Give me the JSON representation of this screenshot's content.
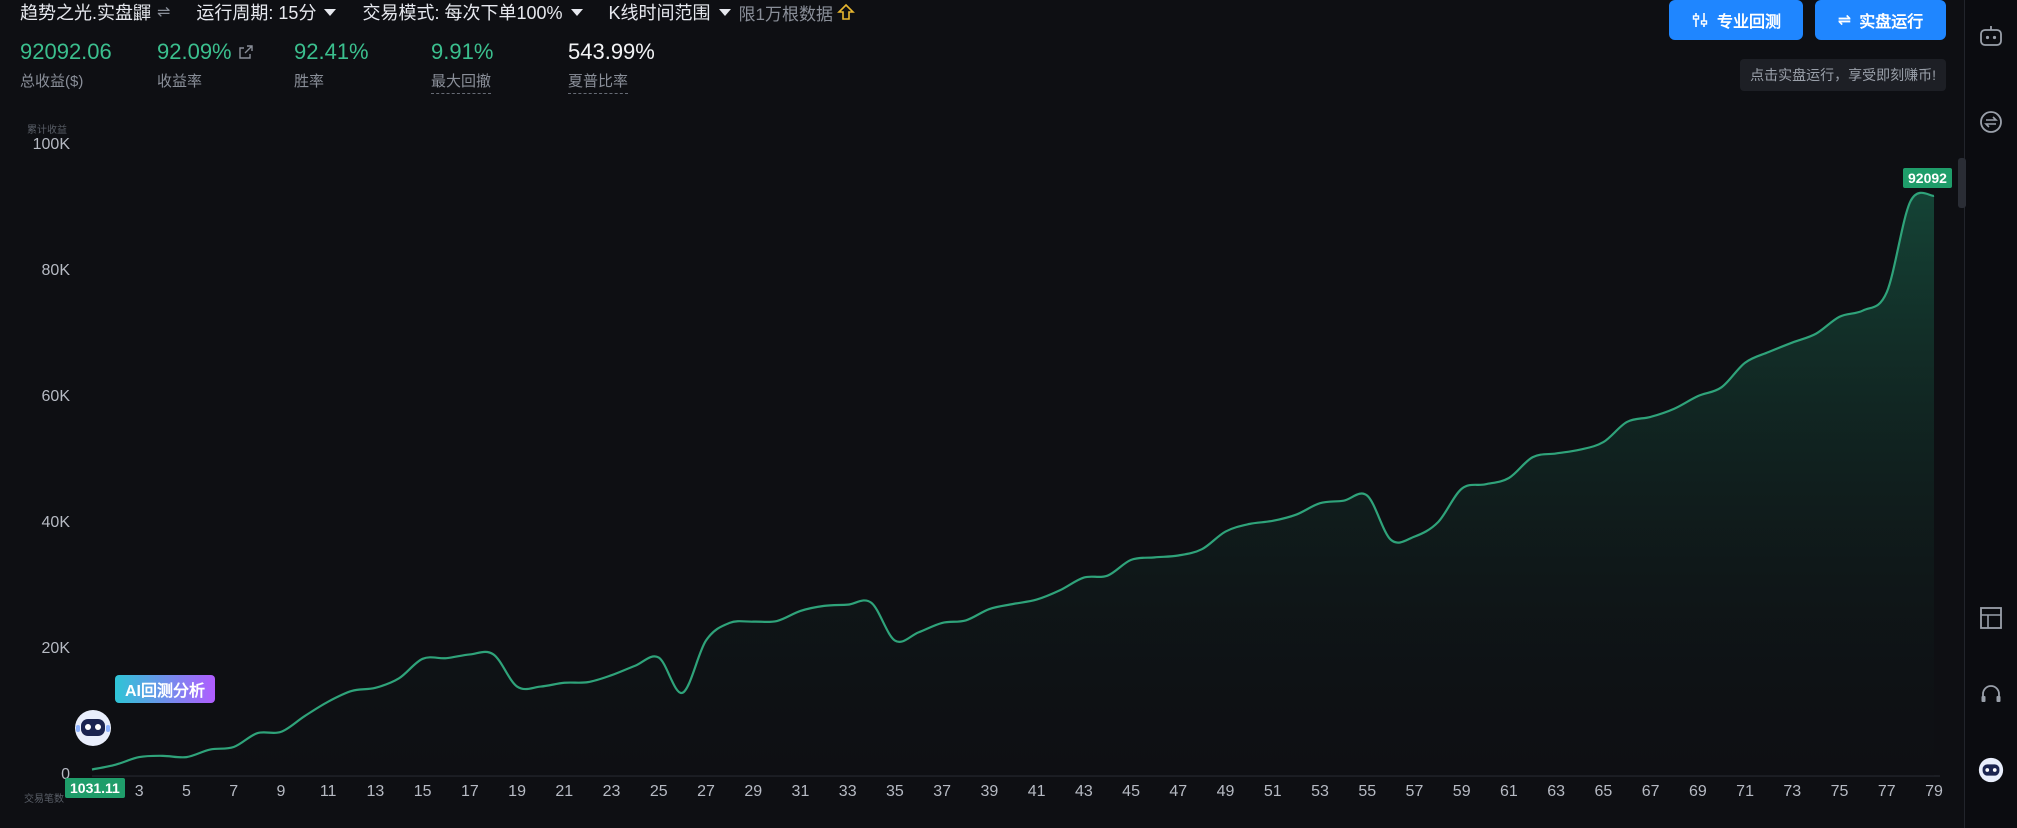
{
  "header": {
    "strategy_name": "趋势之光.实盘鼲",
    "period_label": "运行周期: 15分",
    "mode_label": "交易模式: 每次下单100%",
    "range_label": "K线时间范围",
    "range_note": "限1万根数据"
  },
  "buttons": {
    "pro_backtest": "专业回测",
    "live_run": "实盘运行"
  },
  "tip": "点击实盘运行，享受即刻赚币!",
  "stats": [
    {
      "value": "92092.06",
      "label": "总收益($)"
    },
    {
      "value": "92.09%",
      "label": "收益率"
    },
    {
      "value": "92.41%",
      "label": "胜率"
    },
    {
      "value": "9.91%",
      "label": "最大回撤"
    },
    {
      "value": "543.99%",
      "label": "夏普比率"
    }
  ],
  "chart_meta": {
    "y_title": "累计收益",
    "x_title": "交易笔数",
    "ai_tag": "AI回测分析",
    "start_label": "1031.11",
    "end_label": "92092"
  },
  "colors": {
    "line": "#2fa37a",
    "accent": "#1f86ff",
    "positive": "#3bbf8e"
  },
  "chart_data": {
    "type": "area",
    "ylim": [
      0,
      100000
    ],
    "yticks": [
      "100K",
      "80K",
      "60K",
      "40K",
      "20K",
      "0"
    ],
    "xticks": [
      "3",
      "5",
      "7",
      "9",
      "11",
      "13",
      "15",
      "17",
      "19",
      "21",
      "23",
      "25",
      "27",
      "29",
      "31",
      "33",
      "35",
      "37",
      "39",
      "41",
      "43",
      "45",
      "47",
      "49",
      "51",
      "53",
      "55",
      "57",
      "59",
      "61",
      "63",
      "65",
      "67",
      "69",
      "71",
      "73",
      "75",
      "77",
      "79"
    ],
    "x": [
      1,
      2,
      3,
      4,
      5,
      6,
      7,
      8,
      9,
      10,
      11,
      12,
      13,
      14,
      15,
      16,
      17,
      18,
      19,
      20,
      21,
      22,
      23,
      24,
      25,
      26,
      27,
      28,
      29,
      30,
      31,
      32,
      33,
      34,
      35,
      36,
      37,
      38,
      39,
      40,
      41,
      42,
      43,
      44,
      45,
      46,
      47,
      48,
      49,
      50,
      51,
      52,
      53,
      54,
      55,
      56,
      57,
      58,
      59,
      60,
      61,
      62,
      63,
      64,
      65,
      66,
      67,
      68,
      69,
      70,
      71,
      72,
      73,
      74,
      75,
      76,
      77,
      78,
      79
    ],
    "values": [
      1031,
      1800,
      3000,
      3200,
      3000,
      4200,
      4600,
      6800,
      7000,
      9500,
      11800,
      13500,
      14000,
      15500,
      18600,
      18700,
      19300,
      19300,
      14200,
      14200,
      14800,
      14900,
      16000,
      17500,
      18800,
      13200,
      21500,
      24300,
      24500,
      24600,
      26200,
      27000,
      27200,
      27500,
      21500,
      22800,
      24300,
      24700,
      26500,
      27300,
      28000,
      29500,
      31500,
      31800,
      34300,
      34700,
      35000,
      36000,
      38800,
      40000,
      40500,
      41500,
      43300,
      43700,
      44500,
      37500,
      38000,
      40300,
      45600,
      46300,
      47300,
      50600,
      51200,
      51800,
      53000,
      56200,
      57000,
      58300,
      60300,
      61700,
      65600,
      67300,
      68800,
      70200,
      72900,
      73900,
      76800,
      91200,
      92092
    ]
  }
}
